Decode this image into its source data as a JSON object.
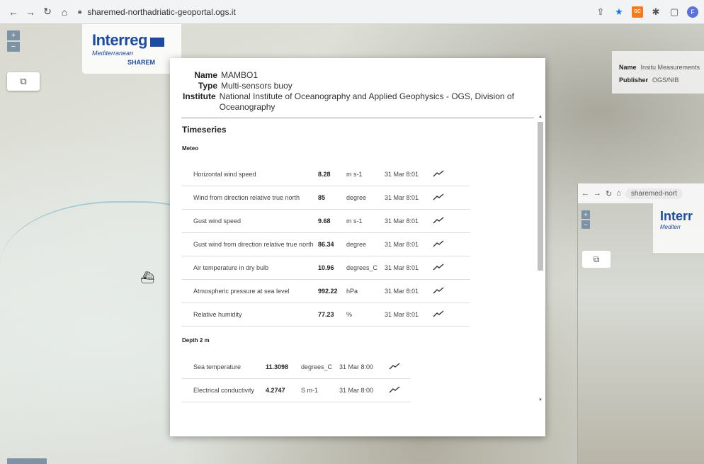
{
  "browser": {
    "url": "sharemed-northadriatic-geoportal.ogs.it",
    "profile_initial": "F",
    "sc_badge": "SC"
  },
  "map": {
    "zoom_in": "+",
    "zoom_out": "−",
    "logo_title": "Interreg",
    "logo_sub": "Mediterranean",
    "logo_project": "SHAREM"
  },
  "right_panel": {
    "name_label": "Name",
    "name_value": "Insitu Measurements",
    "publisher_label": "Publisher",
    "publisher_value": "OGS/NIB"
  },
  "embedded": {
    "url": "sharemed-nort",
    "logo_title": "Interr",
    "logo_sub": "Mediterr"
  },
  "station": {
    "name_label": "Name",
    "name": "MAMBO1",
    "type_label": "Type",
    "type": "Multi-sensors buoy",
    "institute_label": "Institute",
    "institute": "National Institute of Oceanography and Applied Geophysics - OGS, Division of Oceanography"
  },
  "timeseries": {
    "title": "Timeseries",
    "groups": [
      {
        "title": "Meteo",
        "rows": [
          {
            "name": "Horizontal wind speed",
            "value": "8.28",
            "unit": "m s-1",
            "time": "31 Mar 8:01"
          },
          {
            "name": "Wind from direction relative true north",
            "value": "85",
            "unit": "degree",
            "time": "31 Mar 8:01"
          },
          {
            "name": "Gust wind speed",
            "value": "9.68",
            "unit": "m s-1",
            "time": "31 Mar 8:01"
          },
          {
            "name": "Gust wind from direction relative true north",
            "value": "86.34",
            "unit": "degree",
            "time": "31 Mar 8:01"
          },
          {
            "name": "Air temperature in dry bulb",
            "value": "10.96",
            "unit": "degrees_C",
            "time": "31 Mar 8:01"
          },
          {
            "name": "Atmospheric pressure at sea level",
            "value": "992.22",
            "unit": "hPa",
            "time": "31 Mar 8:01"
          },
          {
            "name": "Relative humidity",
            "value": "77.23",
            "unit": "%",
            "time": "31 Mar 8:01"
          }
        ]
      },
      {
        "title": "Depth 2 m",
        "rows": [
          {
            "name": "Sea temperature",
            "value": "11.3098",
            "unit": "degrees_C",
            "time": "31 Mar 8:00"
          },
          {
            "name": "Electrical conductivity",
            "value": "4.2747",
            "unit": "S m-1",
            "time": "31 Mar 8:00"
          }
        ]
      }
    ]
  }
}
